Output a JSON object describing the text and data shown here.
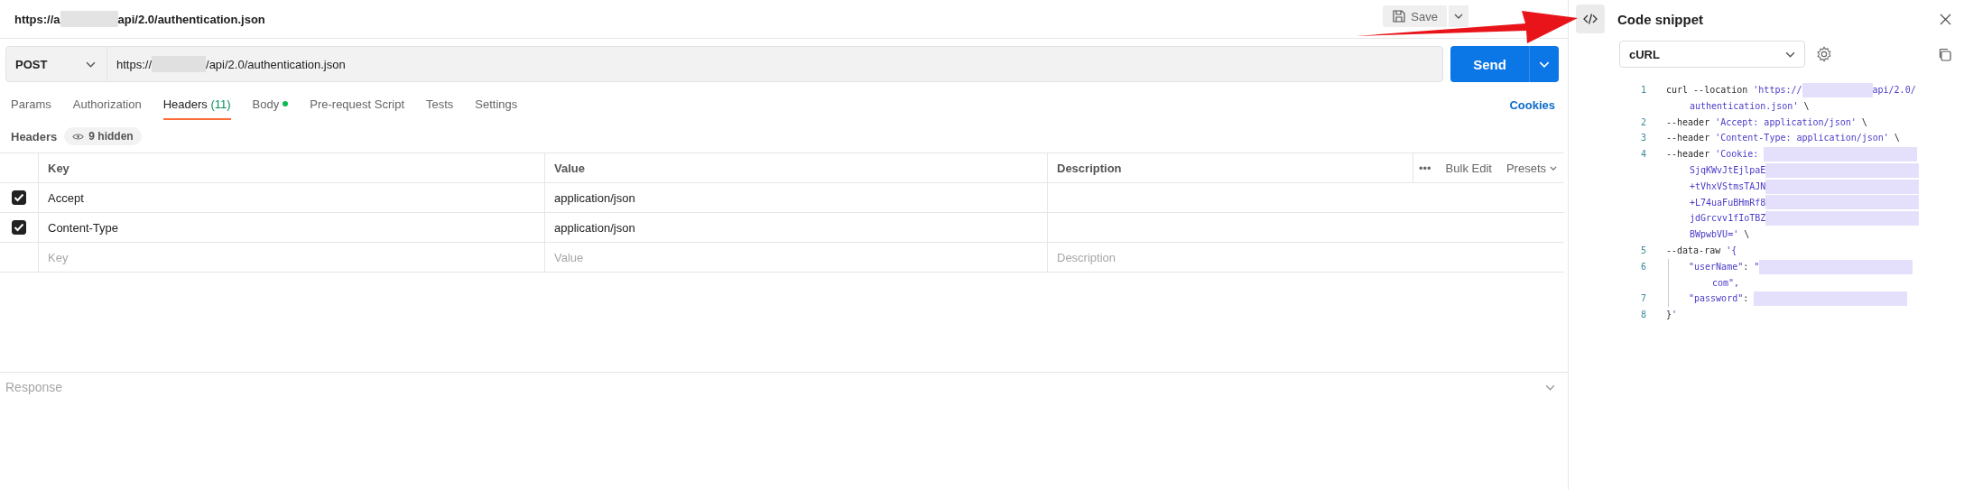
{
  "request_title": {
    "prefix": "https://a",
    "suffix": "api/2.0/authentication.json"
  },
  "toolbar": {
    "save_label": "Save"
  },
  "request": {
    "method": "POST",
    "url_prefix": "https://",
    "url_suffix": "/api/2.0/authentication.json",
    "send_label": "Send"
  },
  "tabs": [
    {
      "label": "Params",
      "selected": false
    },
    {
      "label": "Authorization",
      "selected": false
    },
    {
      "label": "Headers",
      "count": "(11)",
      "selected": true
    },
    {
      "label": "Body",
      "dot": true,
      "selected": false
    },
    {
      "label": "Pre-request Script",
      "selected": false
    },
    {
      "label": "Tests",
      "selected": false
    },
    {
      "label": "Settings",
      "selected": false
    }
  ],
  "cookies_link": "Cookies",
  "headers_section": {
    "title": "Headers",
    "hidden_badge": "9 hidden"
  },
  "table": {
    "columns": [
      "Key",
      "Value",
      "Description"
    ],
    "actions": {
      "more": "•••",
      "bulk_edit": "Bulk Edit",
      "presets": "Presets"
    },
    "rows": [
      {
        "checked": true,
        "key": "Accept",
        "value": "application/json",
        "description": ""
      },
      {
        "checked": true,
        "key": "Content-Type",
        "value": "application/json",
        "description": ""
      }
    ],
    "empty_row": {
      "key_placeholder": "Key",
      "value_placeholder": "Value",
      "description_placeholder": "Description"
    }
  },
  "response": {
    "title": "Response"
  },
  "code_snippet": {
    "title": "Code snippet",
    "language": "cURL",
    "code_rows": [
      {
        "number": "1",
        "segments": [
          {
            "kind": "plain",
            "text": "curl --location "
          },
          {
            "kind": "string",
            "text": "'https://"
          },
          {
            "kind": "redacted"
          },
          {
            "kind": "string",
            "text": "api/2.0/"
          }
        ]
      },
      {
        "wrapped": true,
        "segments": [
          {
            "kind": "string",
            "text": "authentication.json'"
          },
          {
            "kind": "plain",
            "text": " \\"
          }
        ]
      },
      {
        "number": "2",
        "segments": [
          {
            "kind": "plain",
            "text": "--header "
          },
          {
            "kind": "string",
            "text": "'Accept: application/json'"
          },
          {
            "kind": "plain",
            "text": " \\"
          }
        ]
      },
      {
        "number": "3",
        "segments": [
          {
            "kind": "plain",
            "text": "--header "
          },
          {
            "kind": "string",
            "text": "'Content-Type: application/json'"
          },
          {
            "kind": "plain",
            "text": " \\"
          }
        ]
      },
      {
        "number": "4",
        "segments": [
          {
            "kind": "plain",
            "text": "--header "
          },
          {
            "kind": "string",
            "text": "'Cookie: "
          },
          {
            "kind": "redacted"
          }
        ]
      },
      {
        "wrapped": true,
        "segments": [
          {
            "kind": "string",
            "text": "SjqKWvJtEjlpaE"
          },
          {
            "kind": "redacted"
          }
        ]
      },
      {
        "wrapped": true,
        "segments": [
          {
            "kind": "string",
            "text": "+tVhxVStmsTAJN"
          },
          {
            "kind": "redacted"
          }
        ]
      },
      {
        "wrapped": true,
        "segments": [
          {
            "kind": "string",
            "text": "+L74uaFuBHmRf8"
          },
          {
            "kind": "redacted"
          }
        ]
      },
      {
        "wrapped": true,
        "segments": [
          {
            "kind": "string",
            "text": "jdGrcvv1fIoTBZ"
          },
          {
            "kind": "redacted"
          }
        ]
      },
      {
        "wrapped": true,
        "segments": [
          {
            "kind": "string",
            "text": "BWpwbVU='"
          },
          {
            "kind": "plain",
            "text": " \\"
          }
        ]
      },
      {
        "number": "5",
        "segments": [
          {
            "kind": "plain",
            "text": "--data-raw "
          },
          {
            "kind": "string",
            "text": "'{"
          }
        ]
      },
      {
        "number": "6",
        "indent": true,
        "segments": [
          {
            "kind": "string",
            "text": "\"userName\""
          },
          {
            "kind": "plain",
            "text": ": "
          },
          {
            "kind": "string",
            "text": "\""
          },
          {
            "kind": "redacted"
          }
        ]
      },
      {
        "wrapped": true,
        "indent": true,
        "segments": [
          {
            "kind": "string",
            "text": "com\","
          }
        ]
      },
      {
        "number": "7",
        "indent": true,
        "segments": [
          {
            "kind": "string",
            "text": "\"password\""
          },
          {
            "kind": "plain",
            "text": ": "
          },
          {
            "kind": "redacted"
          }
        ]
      },
      {
        "number": "8",
        "segments": [
          {
            "kind": "plain",
            "text": "}"
          },
          {
            "kind": "string",
            "text": "'"
          }
        ]
      }
    ]
  }
}
